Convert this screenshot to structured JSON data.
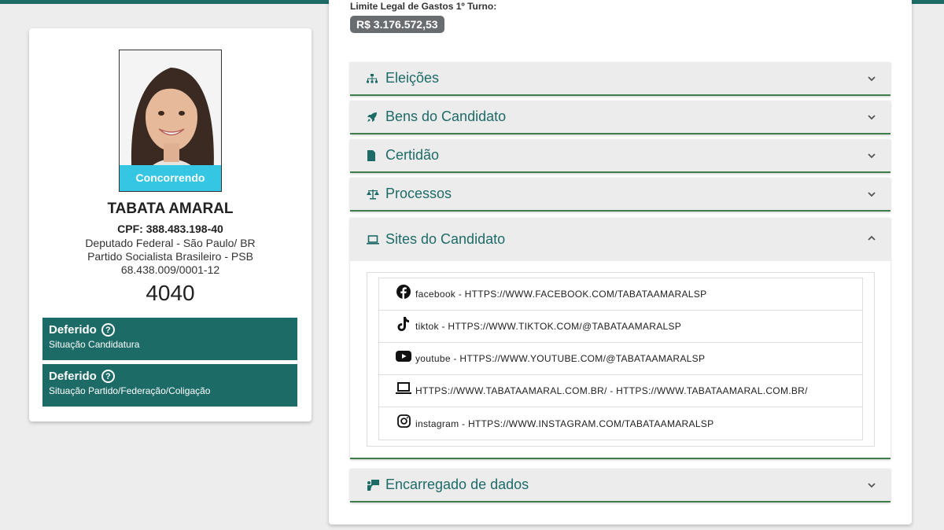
{
  "candidate": {
    "status_label": "Concorrendo",
    "name": "TABATA AMARAL",
    "cpf": "CPF: 388.483.198-40",
    "office": "Deputado Federal - São Paulo/ BR",
    "party": "Partido Socialista Brasileiro - PSB",
    "cnpj": "68.438.009/0001-12",
    "number": "4040",
    "status_boxes": [
      {
        "status": "Deferido",
        "subtitle": "Situação Candidatura"
      },
      {
        "status": "Deferido",
        "subtitle": "Situação Partido/Federação/Coligação"
      }
    ]
  },
  "right": {
    "limit_label": "Limite Legal de Gastos 1º Turno:",
    "limit_value": "R$ 3.176.572,53",
    "sections": [
      {
        "title": "Eleições",
        "icon": "sitemap-icon"
      },
      {
        "title": "Bens do Candidato",
        "icon": "rocket-icon"
      },
      {
        "title": "Certidão",
        "icon": "file-icon"
      },
      {
        "title": "Processos",
        "icon": "scale-icon"
      },
      {
        "title": "Sites do Candidato",
        "icon": "laptop-icon"
      },
      {
        "title": "Encarregado de dados",
        "icon": "person-board-icon"
      }
    ],
    "sites": [
      {
        "icon": "facebook-icon",
        "text": "facebook - HTTPS://WWW.FACEBOOK.COM/TABATAAMARALSP"
      },
      {
        "icon": "tiktok-icon",
        "text": "tiktok - HTTPS://WWW.TIKTOK.COM/@TABATAAMARALSP"
      },
      {
        "icon": "youtube-icon",
        "text": "youtube - HTTPS://WWW.YOUTUBE.COM/@TABATAAMARALSP"
      },
      {
        "icon": "laptop-icon",
        "text": "HTTPS://WWW.TABATAAMARAL.COM.BR/ - HTTPS://WWW.TABATAAMARAL.COM.BR/"
      },
      {
        "icon": "instagram-icon",
        "text": "instagram - HTTPS://WWW.INSTAGRAM.COM/TABATAAMARALSP"
      }
    ]
  },
  "colors": {
    "teal": "#1d6b67",
    "cyan": "#35c6e4",
    "badge_gray": "#6a6d70",
    "accent_green": "#3f7d4c"
  }
}
